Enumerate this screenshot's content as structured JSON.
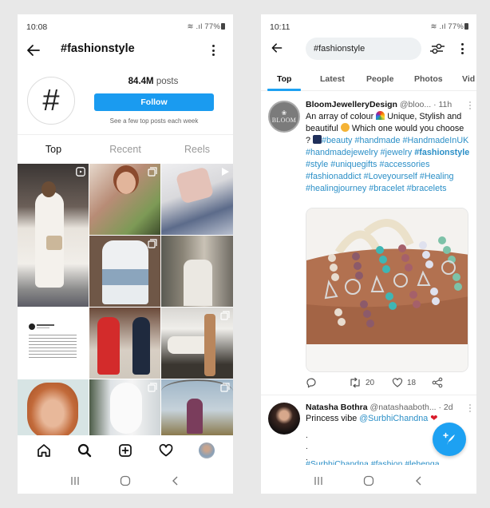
{
  "left_screen": {
    "status_bar": {
      "time": "10:08",
      "battery": "77%"
    },
    "header": {
      "title": "#fashionstyle"
    },
    "profile": {
      "hashtag_symbol": "#",
      "post_count": "84.4M",
      "post_count_suffix": "posts",
      "follow_label": "Follow",
      "follow_note": "See a few top posts each week"
    },
    "tabs": [
      {
        "label": "Top",
        "active": true
      },
      {
        "label": "Recent",
        "active": false
      },
      {
        "label": "Reels",
        "active": false
      }
    ],
    "grid": [
      {
        "subject": "woman in white outfit with straw bag",
        "badge": "reels-icon"
      },
      {
        "subject": "smiling woman with plants",
        "badge": "carousel-icon"
      },
      {
        "subject": "hand holding pink fabric",
        "badge": "video-icon"
      },
      {
        "subject": "white and denim hooded jacket",
        "badge": "carousel-icon"
      },
      {
        "subject": "woman in open-back dress",
        "badge": ""
      },
      {
        "subject": "tweet screenshot",
        "badge": ""
      },
      {
        "subject": "women in red and navy coats",
        "badge": ""
      },
      {
        "subject": "woman in white with knit scarf",
        "badge": "carousel-icon"
      },
      {
        "subject": "red-haired woman selfie",
        "badge": ""
      },
      {
        "subject": "snowy white fur",
        "badge": "carousel-icon"
      },
      {
        "subject": "woman under tree",
        "badge": "carousel-icon"
      }
    ],
    "bottom_nav": [
      "home-icon",
      "search-icon",
      "add-post-icon",
      "activity-heart-icon",
      "profile-avatar"
    ]
  },
  "right_screen": {
    "status_bar": {
      "time": "10:11",
      "battery": "77%"
    },
    "search": {
      "value": "#fashionstyle"
    },
    "tabs": [
      {
        "label": "Top",
        "active": true
      },
      {
        "label": "Latest",
        "active": false
      },
      {
        "label": "People",
        "active": false
      },
      {
        "label": "Photos",
        "active": false
      },
      {
        "label": "Vid",
        "active": false
      }
    ],
    "tweets": [
      {
        "avatar_text": "BLOOM",
        "name": "BloomJewelleryDesign",
        "handle": "@bloo...",
        "time": "· 11h",
        "text_1": "An array of colour",
        "text_2": "Unique, Stylish and beautiful",
        "text_3": "Which one would you choose ?",
        "hashtags": [
          "#beauty",
          "#handmade",
          "#HandmadeInUK",
          "#handmadejewelry",
          "#jewelry",
          "#fashionstyle",
          "#style",
          "#uniquegifts",
          "#accessories",
          "#fashionaddict",
          "#Loveyourself",
          "#Healing",
          "#healingjourney",
          "#bracelet",
          "#bracelets"
        ],
        "media_alt": "beaded bracelets with charms on a wrist",
        "reply_count": "",
        "retweet_count": "20",
        "like_count": "18"
      },
      {
        "name": "Natasha Bothra",
        "handle": "@natashaaboth...",
        "time": "· 2d",
        "text": "Princess vibe",
        "mention": "@SurbhiChandna",
        "dots": [
          ".",
          ".",
          "."
        ],
        "cut_hashtags": "#SurbhiChandna #fashion #lehenga"
      }
    ],
    "fab": {
      "icon": "compose-tweet-icon"
    }
  },
  "colors": {
    "background": "#e8e8e8",
    "instagram_follow": "#1a9bf0",
    "twitter_blue": "#1da1f2",
    "hashtag": "#2b8fc7"
  }
}
